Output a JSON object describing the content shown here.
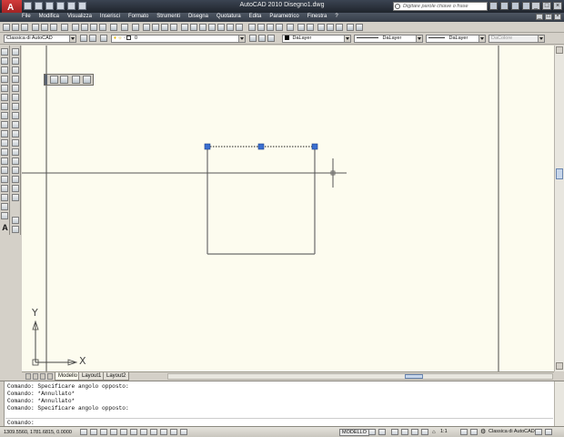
{
  "window": {
    "title": "AutoCAD 2010    Disegno1.dwg",
    "search_placeholder": "Digitare parole chiave o frase"
  },
  "menu": {
    "items": [
      "File",
      "Modifica",
      "Visualizza",
      "Inserisci",
      "Formato",
      "Strumenti",
      "Disegna",
      "Quotatura",
      "Edita",
      "Parametrico",
      "Finestra",
      "?"
    ]
  },
  "toolbar": {
    "workspace": "Classica di AutoCAD",
    "layer": "0",
    "color": "DaLayer",
    "linetype": "DaLayer",
    "lineweight": "DaLayer",
    "plotstyle": "DaColore"
  },
  "ucs": {
    "x_label": "X",
    "y_label": "Y"
  },
  "tabs": [
    "Modello",
    "Layout1",
    "Layout2"
  ],
  "active_tab": "Modello",
  "command_history": [
    "Comando: Specificare angolo opposto:",
    "Comando: *Annullato*",
    "Comando: *Annullato*",
    "Comando: Specificare angolo opposto:"
  ],
  "command_prompt": "Comando:",
  "status": {
    "coordinates": "1309.5560, 1781.6815, 0.0000",
    "space": "MODELLO",
    "annotation_scale": "1:1",
    "workspace": "Classica di AutoCAD"
  },
  "colors": {
    "canvas": "#fdfcef",
    "grip": "#3a6fd0",
    "title_bg": "#2b313b"
  }
}
